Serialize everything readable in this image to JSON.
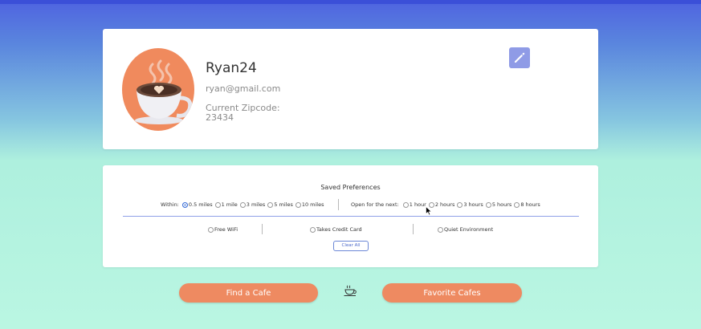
{
  "profile": {
    "username": "Ryan24",
    "email": "ryan@gmail.com",
    "zip_label": "Current Zipcode:",
    "zip_value": "23434",
    "avatar_icon": "coffee-cup-avatar",
    "edit_icon": "pencil-icon"
  },
  "preferences": {
    "title": "Saved Preferences",
    "within_label": "Within:",
    "distance_options": [
      "0.5 miles",
      "1 mile",
      "3 miles",
      "5 miles",
      "10 miles"
    ],
    "distance_selected": "0.5 miles",
    "open_label": "Open for the next:",
    "hours_options": [
      "1 hour",
      "2 hours",
      "3 hours",
      "5 hours",
      "8 hours"
    ],
    "amenities": [
      "Free WiFi",
      "Takes Credit Card",
      "Quiet Environment"
    ],
    "clear_label": "Clear All"
  },
  "actions": {
    "find_label": "Find a Cafe",
    "favorites_label": "Favorite Cafes",
    "center_icon": "coffee-cup-icon"
  },
  "colors": {
    "accent_orange": "#ee8a61",
    "accent_blue": "#3b6fd8",
    "edit_button": "#8f9be6"
  }
}
